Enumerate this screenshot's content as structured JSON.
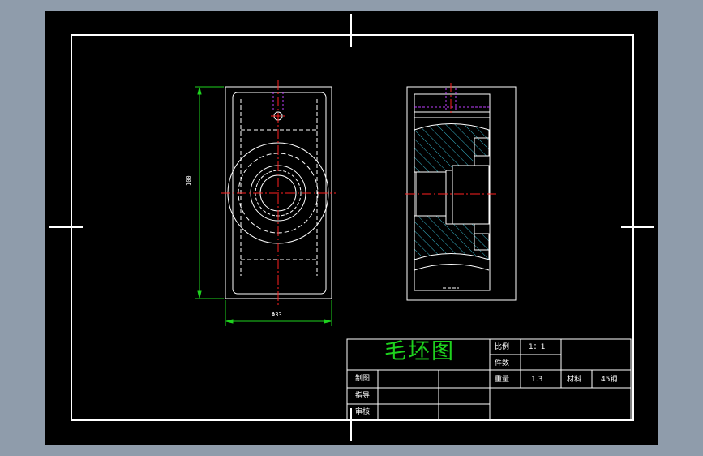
{
  "title_block": {
    "title": "毛坯图",
    "scale_label": "比例",
    "scale_value": "1：1",
    "quantity_label": "件数",
    "weight_label": "重量",
    "weight_value": "1.3",
    "material_label": "材料",
    "material_value": "45钢",
    "drawn_label": "制图",
    "guide_label": "指导",
    "review_label": "审核"
  },
  "dimensions": {
    "height": "100",
    "width": "Φ33"
  },
  "colors": {
    "background": "#8f9cab",
    "sheet": "#000000",
    "outline": "#ffffff",
    "centerline": "#ff2020",
    "dimension": "#1ed21e",
    "hatch": "#36b4c8",
    "hidden_feature": "#c040ff",
    "title_text": "#1ed21e"
  }
}
